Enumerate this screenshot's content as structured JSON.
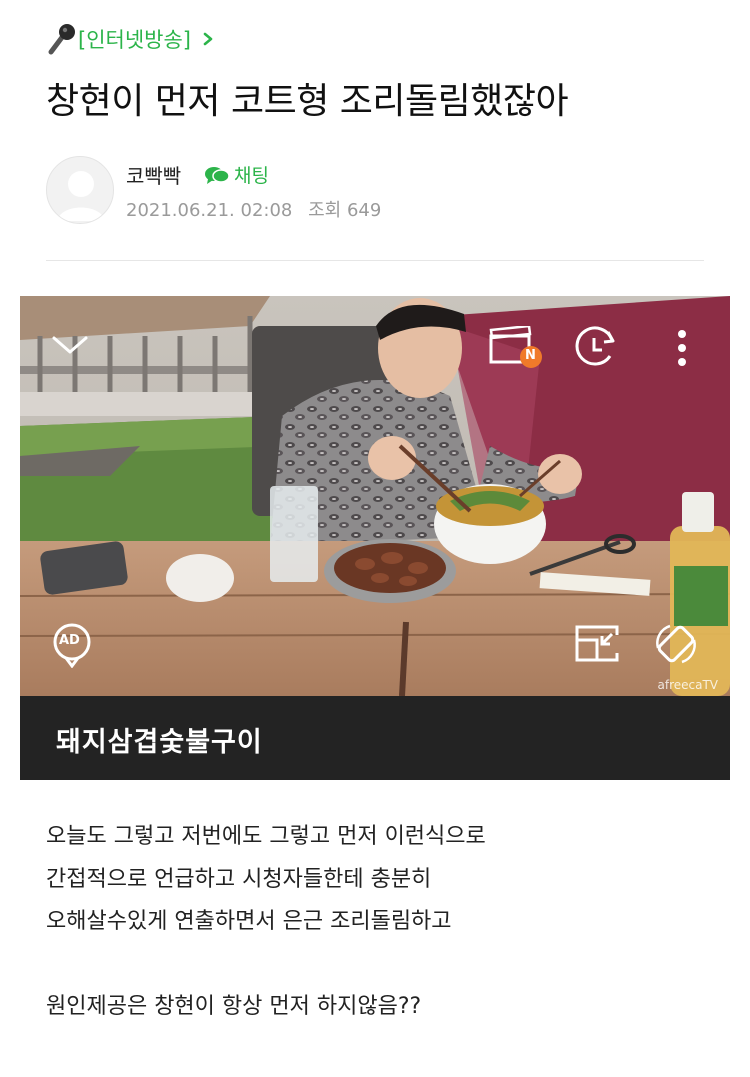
{
  "category": {
    "label": "[인터넷방송]",
    "icon": "microphone-icon"
  },
  "post": {
    "title": "창현이 먼저 코트형 조리돌림했잖아",
    "author": "코빡빡",
    "chat_label": "채팅",
    "date": "2021.06.21. 02:08",
    "views": "조회 649"
  },
  "media": {
    "caption": "돼지삼겹숯불구이",
    "watermark": "afreecaTV",
    "badge_new": "N",
    "ad_label": "AD"
  },
  "body": {
    "paragraph1": [
      "오늘도 그렇고 저번에도 그렇고 먼저 이런식으로",
      "간접적으로 언급하고 시청자들한테 충분히",
      "오해살수있게 연출하면서 은근 조리돌림하고"
    ],
    "paragraph2": [
      "원인제공은 창현이 항상 먼저 하지않음??"
    ]
  },
  "colors": {
    "accent": "#2cb44a",
    "caption_bg": "#232323",
    "badge": "#f07a2a"
  }
}
